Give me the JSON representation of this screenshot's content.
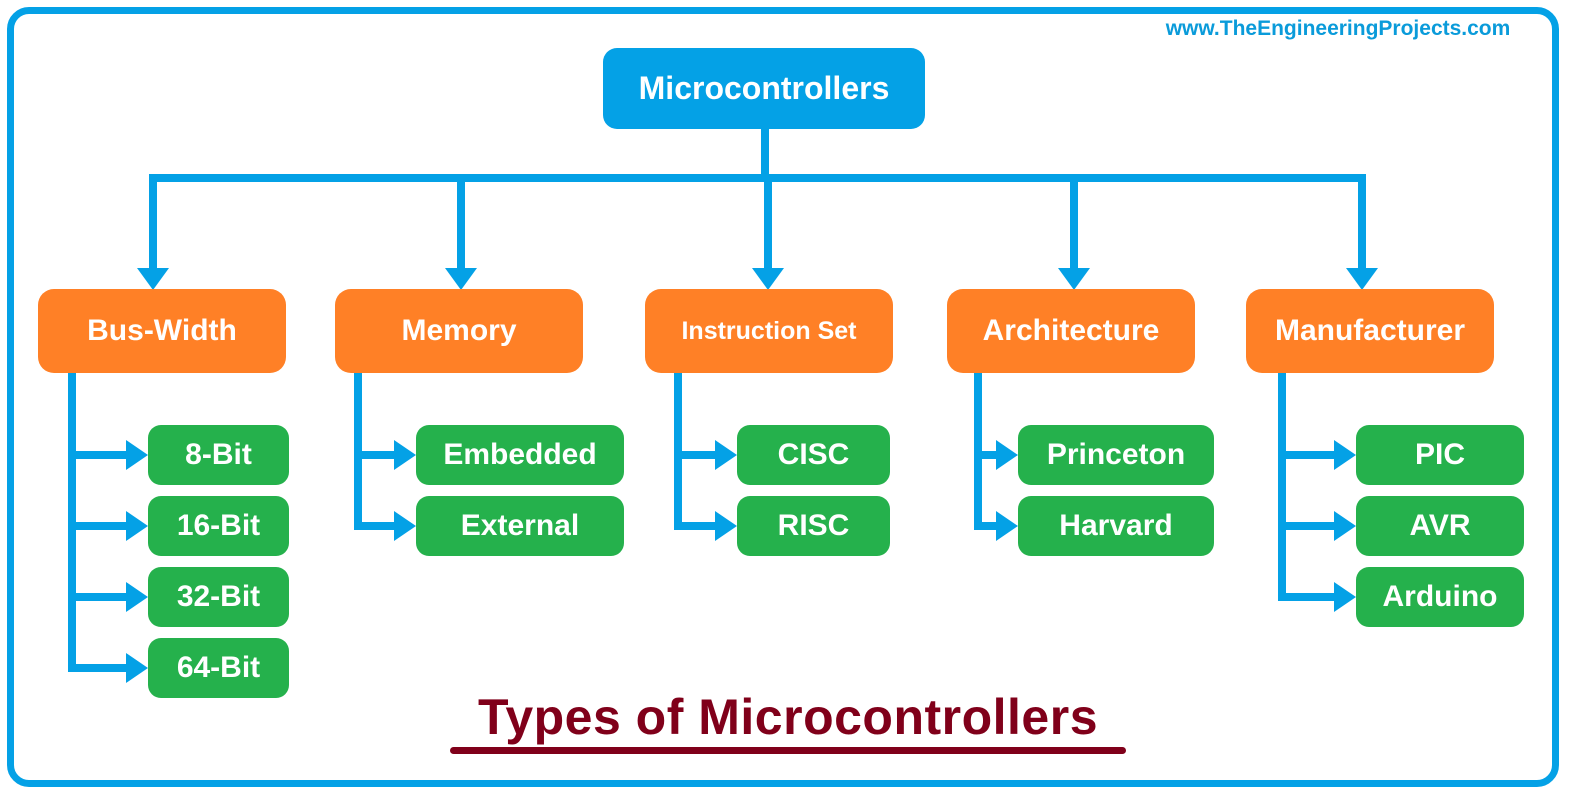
{
  "watermark": "www.TheEngineeringProjects.com",
  "root": {
    "label": "Microcontrollers"
  },
  "categories": [
    {
      "label": "Bus-Width",
      "children": [
        "8-Bit",
        "16-Bit",
        "32-Bit",
        "64-Bit"
      ]
    },
    {
      "label": "Memory",
      "children": [
        "Embedded",
        "External"
      ]
    },
    {
      "label": "Instruction Set",
      "children": [
        "CISC",
        "RISC"
      ]
    },
    {
      "label": "Architecture",
      "children": [
        "Princeton",
        "Harvard"
      ]
    },
    {
      "label": "Manufacturer",
      "children": [
        "PIC",
        "AVR",
        "Arduino"
      ]
    }
  ],
  "title": "Types of Microcontrollers",
  "colors": {
    "connector": "#04A1E6",
    "root": "#04A1E6",
    "category": "#FF8026",
    "leaf": "#25B14C",
    "title": "#80001A"
  }
}
